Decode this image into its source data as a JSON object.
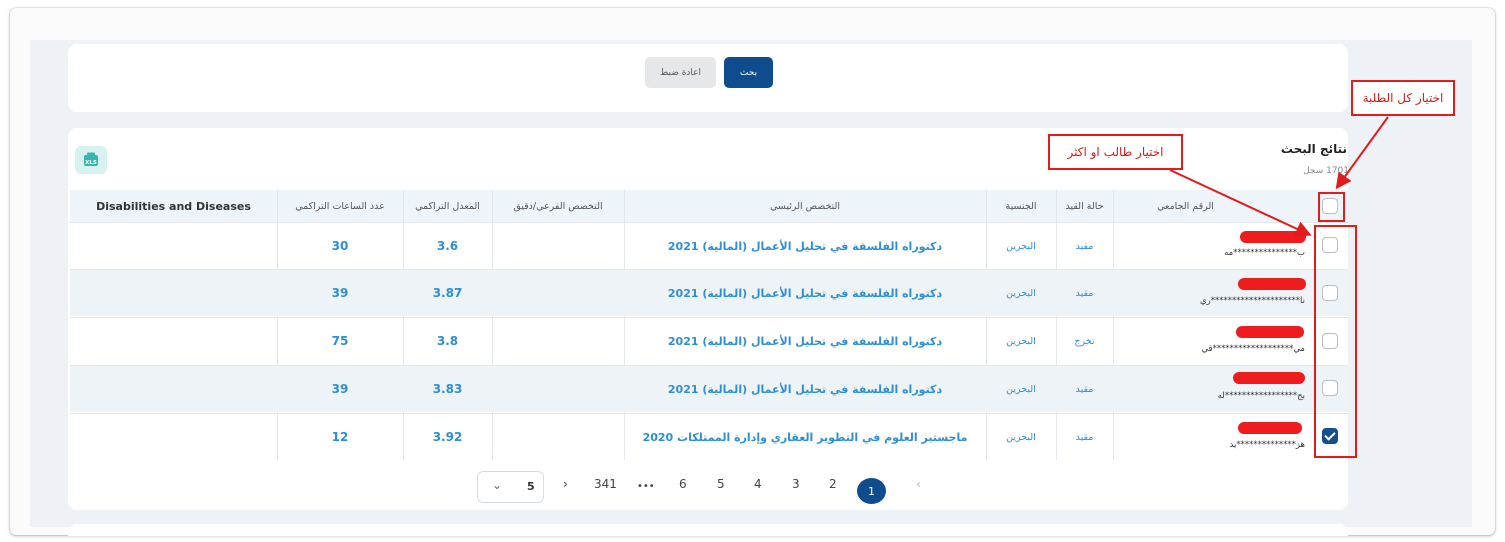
{
  "search_form": {
    "search_button": "بحث",
    "reset_button": "اعادة ضبط"
  },
  "results": {
    "title": "نتائج البحث",
    "count": "1701 سجل",
    "export_icon": "excel-export-icon",
    "columns": [
      "الرقم الجامعي",
      "حالة القيد",
      "الجنسية",
      "التخصص الرئيسي",
      "التخصص الفرعي/دقيق",
      "المعدل التراكمي",
      "عدد الساعات التراكمي",
      "Disabilities and Diseases"
    ],
    "rows": [
      {
        "selected": false,
        "student_id": "ب***************مه",
        "status": "مقيد",
        "nationality": "البحرين",
        "major": "دكتوراه الفلسفة في تحليل الأعمال (المالية) 2021",
        "minor": "",
        "gpa": "3.6",
        "hours": "30",
        "disabilities": ""
      },
      {
        "selected": false,
        "student_id": "نا*********************ري",
        "status": "مقيد",
        "nationality": "البحرين",
        "major": "دكتوراه الفلسفة في تحليل الأعمال (المالية) 2021",
        "minor": "",
        "gpa": "3.87",
        "hours": "39",
        "disabilities": ""
      },
      {
        "selected": false,
        "student_id": "مي*******************قي",
        "status": "تخرج",
        "nationality": "البحرين",
        "major": "دكتوراه الفلسفة في تحليل الأعمال (المالية) 2021",
        "minor": "",
        "gpa": "3.8",
        "hours": "75",
        "disabilities": ""
      },
      {
        "selected": false,
        "student_id": "بح*****************له",
        "status": "مقيد",
        "nationality": "البحرين",
        "major": "دكتوراه الفلسفة في تحليل الأعمال (المالية) 2021",
        "minor": "",
        "gpa": "3.83",
        "hours": "39",
        "disabilities": ""
      },
      {
        "selected": true,
        "student_id": "هز**************يد",
        "status": "مقيد",
        "nationality": "البحرين",
        "major": "ماجستير العلوم في التطوير العقاري وإدارة الممتلكات 2020",
        "minor": "",
        "gpa": "3.92",
        "hours": "12",
        "disabilities": ""
      }
    ]
  },
  "pagination": {
    "pages": [
      "1",
      "2",
      "3",
      "4",
      "5",
      "6"
    ],
    "ellipsis": "•••",
    "last_page": "341",
    "current": "1",
    "page_size": "5",
    "prev": "‹",
    "next": "›",
    "dropdown": "⌄"
  },
  "annotations": {
    "select_all": "اختيار كل الطلبة",
    "select_one": "اختيار طالب او اكثر"
  },
  "colors": {
    "primary": "#0f4c8e",
    "link": "#2d8fd6",
    "annotation": "#e21b1b"
  }
}
